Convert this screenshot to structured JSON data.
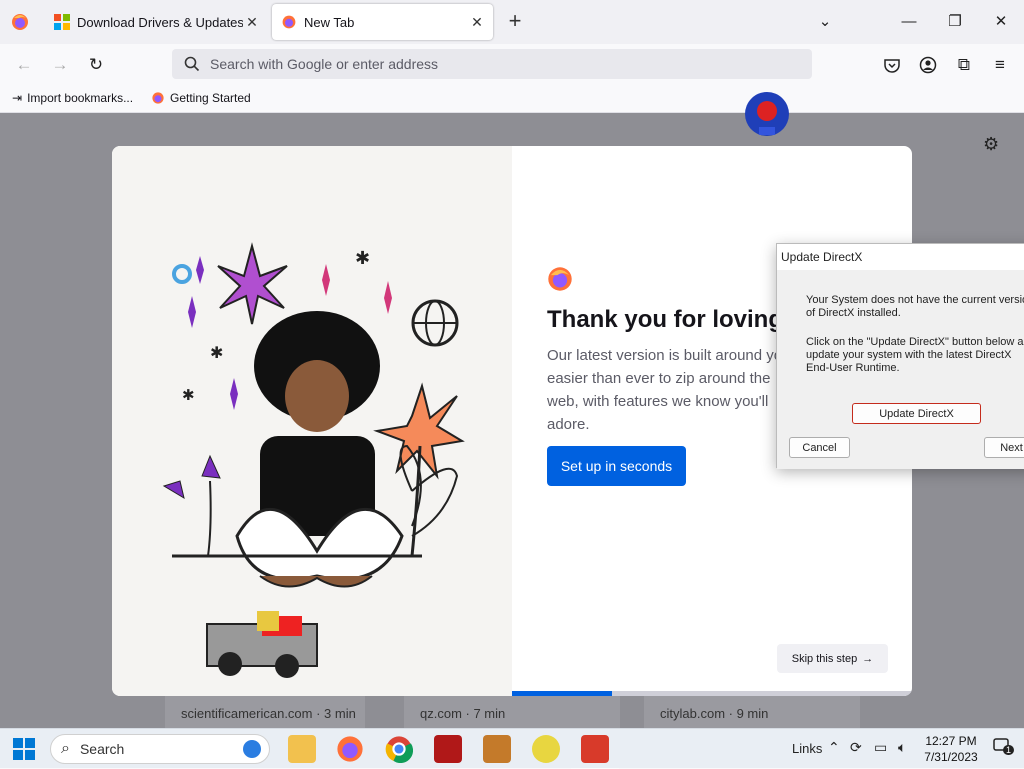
{
  "tabs": [
    {
      "label": "Download Drivers & Updates fo",
      "icon": "windows-logo-icon"
    },
    {
      "label": "New Tab",
      "icon": "firefox-icon"
    }
  ],
  "navbar": {
    "search_placeholder": "Search with Google or enter address"
  },
  "bookmarks": [
    {
      "label": "Import bookmarks...",
      "icon": "import-icon"
    },
    {
      "label": "Getting Started",
      "icon": "firefox-icon"
    }
  ],
  "onboarding": {
    "headline": "Thank you for loving F",
    "subtext": "Our latest version is built around you, easier than ever to zip around the web, with features we know you'll adore.",
    "setup_button": "Set up in seconds",
    "skip_button": "Skip this step",
    "progress_fraction": 0.25
  },
  "top_sites": [
    {
      "label": "scientificamerican.com · 3 min"
    },
    {
      "label": "qz.com · 7 min"
    },
    {
      "label": "citylab.com · 9 min"
    }
  ],
  "directx_dialog": {
    "title": "Update DirectX",
    "message1": "Your System does not have the current version of DirectX installed.",
    "message2": "Click on the \"Update DirectX\" button below and update your system with the latest DirectX End-User Runtime.",
    "update_button": "Update DirectX",
    "cancel_button": "Cancel",
    "next_button": "Next"
  },
  "taskbar": {
    "search_label": "Search",
    "links_label": "Links",
    "time": "12:27 PM",
    "date": "7/31/2023",
    "notification_count": "1"
  },
  "colors": {
    "accent": "#0061e0",
    "firefox_orange": "#ff7139"
  }
}
